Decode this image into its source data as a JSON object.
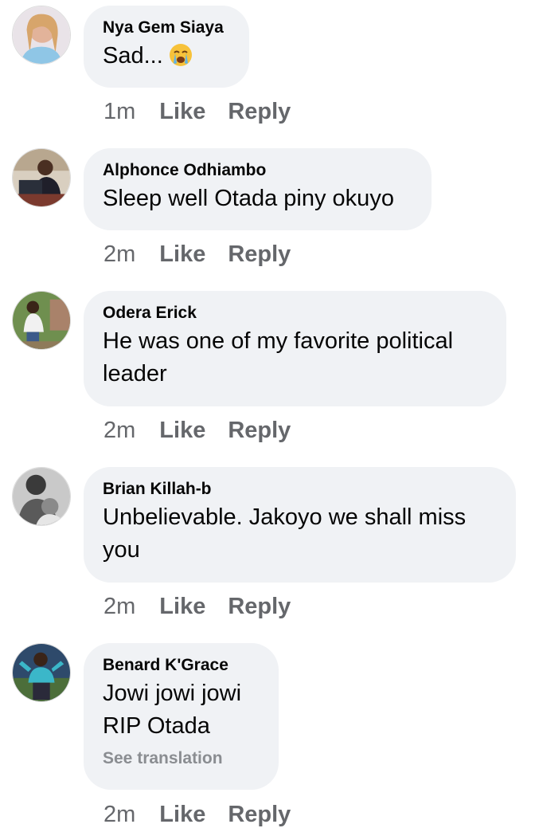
{
  "comments": [
    {
      "author": "Nya Gem Siaya",
      "text": "Sad...",
      "emoji": "crying-face-icon",
      "time": "1m",
      "like": "Like",
      "reply": "Reply"
    },
    {
      "author": "Alphonce Odhiambo",
      "text": "Sleep well Otada piny okuyo",
      "time": "2m",
      "like": "Like",
      "reply": "Reply"
    },
    {
      "author": "Odera Erick",
      "text_lines": [
        "He was one of my favorite political",
        "leader"
      ],
      "time": "2m",
      "like": "Like",
      "reply": "Reply"
    },
    {
      "author": "Brian Killah-b",
      "text_lines": [
        "Unbelievable. Jakoyo we shall miss",
        "you"
      ],
      "time": "2m",
      "like": "Like",
      "reply": "Reply"
    },
    {
      "author": "Benard K'Grace",
      "text_lines": [
        "Jowi jowi jowi",
        "RIP Otada"
      ],
      "see_translation": "See translation",
      "time": "2m",
      "like": "Like",
      "reply": "Reply"
    }
  ],
  "colors": {
    "bubble": "#f0f2f5",
    "meta": "#65676b",
    "muted": "#8a8d91"
  }
}
